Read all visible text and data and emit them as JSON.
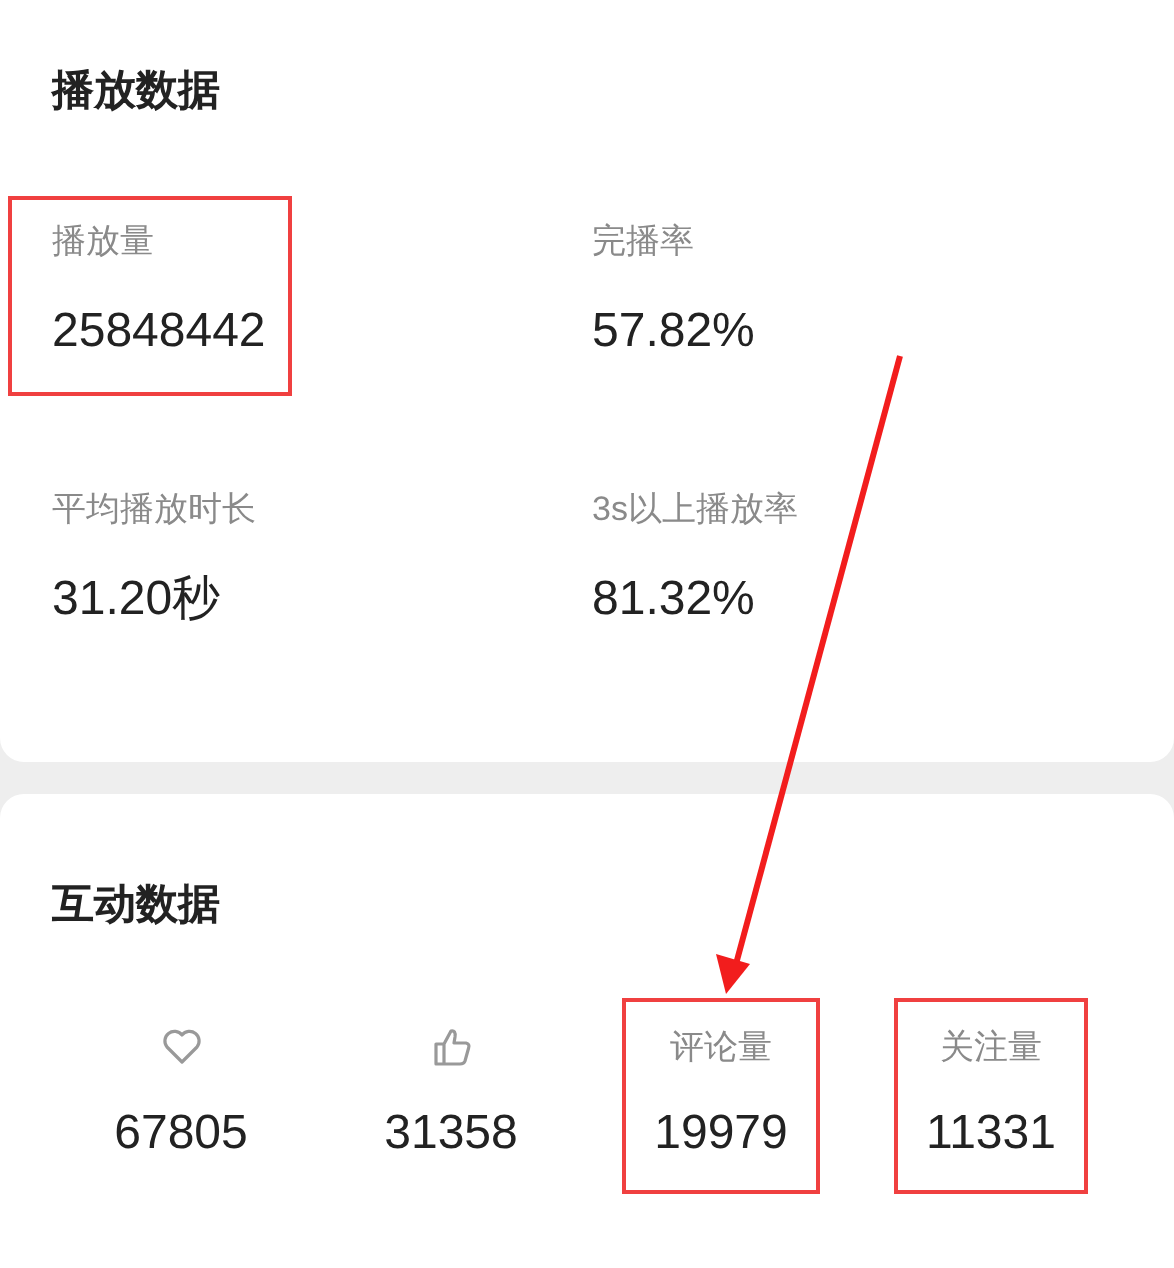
{
  "playback": {
    "title": "播放数据",
    "metrics": [
      {
        "label": "播放量",
        "value": "25848442",
        "highlighted": true
      },
      {
        "label": "完播率",
        "value": "57.82%",
        "highlighted": false
      },
      {
        "label": "平均播放时长",
        "value": "31.20秒",
        "highlighted": false
      },
      {
        "label": "3s以上播放率",
        "value": "81.32%",
        "highlighted": false
      }
    ]
  },
  "interaction": {
    "title": "互动数据",
    "items": [
      {
        "kind": "heart",
        "value": "67805",
        "highlighted": false
      },
      {
        "kind": "thumb",
        "value": "31358",
        "highlighted": false
      },
      {
        "kind": "label",
        "label": "评论量",
        "value": "19979",
        "highlighted": true
      },
      {
        "kind": "label",
        "label": "关注量",
        "value": "11331",
        "highlighted": true
      }
    ]
  }
}
